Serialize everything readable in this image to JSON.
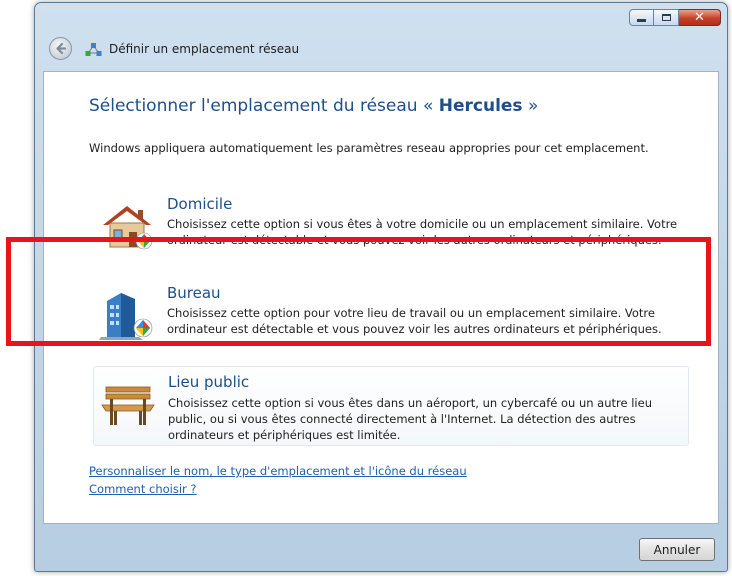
{
  "window": {
    "title": "Définir un emplacement réseau",
    "controls": {
      "minimize": "minimize-icon",
      "maximize": "maximize-icon",
      "close": "close-icon"
    }
  },
  "header": {
    "heading_prefix": "Sélectionner l'emplacement du réseau « ",
    "network_name": "Hercules",
    "heading_suffix": " »",
    "description": "Windows appliquera automatiquement les paramètres reseau appropries pour cet emplacement."
  },
  "options": [
    {
      "title": "Domicile",
      "description": "Choisissez cette option si vous êtes à votre domicile ou un emplacement similaire. Votre ordinateur est détectable et vous pouvez voir les autres ordinateurs et périphériques.",
      "icon": "home-icon"
    },
    {
      "title": "Bureau",
      "description": "Choisissez cette option pour votre lieu de travail ou un emplacement similaire. Votre ordinateur est détectable et vous pouvez voir les autres ordinateurs et périphériques.",
      "icon": "office-building-icon"
    },
    {
      "title": "Lieu public",
      "description": "Choisissez cette option si vous êtes dans un aéroport, un cybercafé ou un autre lieu public, ou si vous êtes connecté directement à l'Internet. La détection des autres ordinateurs et périphériques est limitée.",
      "icon": "park-bench-icon"
    }
  ],
  "links": {
    "customize": "Personnaliser le nom, le type d'emplacement et l'icône du réseau",
    "help": "Comment choisir ?"
  },
  "footer": {
    "cancel_label": "Annuler"
  },
  "colors": {
    "heading": "#1d4f8c",
    "link": "#1f5fae",
    "highlight": "#e8141b",
    "frame": "#b7cde2"
  }
}
